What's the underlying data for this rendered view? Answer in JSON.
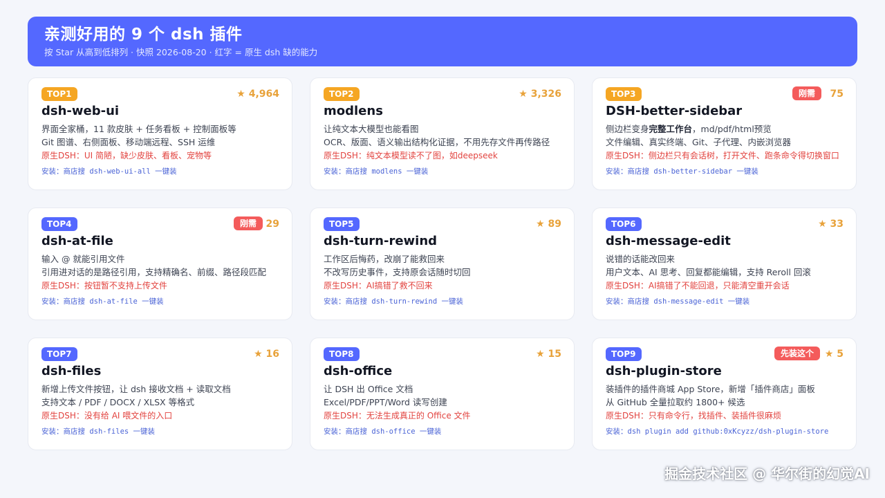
{
  "header": {
    "title": "亲测好用的 9 个 dsh 插件",
    "subtitle": "按 Star 从高到低排列 · 快照 2026-08-20 · 红字 = 原生 dsh 缺的能力"
  },
  "cards": [
    {
      "rank": "TOP1",
      "stars": "★ 4,964",
      "badge": "",
      "name": "dsh-web-ui",
      "desc1": "界面全家桶，11 款皮肤 + 任务看板 + 控制面板等",
      "desc2": "Git 图谱、右侧面板、移动端远程、SSH 运维",
      "native": "原生DSH：UI 简陋，缺少皮肤、看板、宠物等",
      "install": "安装：商店搜 dsh-web-ui-all 一键装"
    },
    {
      "rank": "TOP2",
      "stars": "★ 3,326",
      "badge": "",
      "name": "modlens",
      "desc1": "让纯文本大模型也能看图",
      "desc2": "OCR、版面、语义输出结构化证据，不用先存文件再传路径",
      "native": "原生DSH：纯文本模型读不了图，如deepseek",
      "install": "安装：商店搜 modlens 一键装"
    },
    {
      "rank": "TOP3",
      "stars": "75",
      "badge": "刚需",
      "name": "DSH-better-sidebar",
      "desc1_pre": "侧边栏变身",
      "desc1_bold": "完整工作台",
      "desc1_post": "，md/pdf/html预览",
      "desc2": "文件编辑、真实终端、Git、子代理、内嵌浏览器",
      "native": "原生DSH：侧边栏只有会话树，打开文件、跑条命令得切换窗口",
      "install": "安装：商店搜 dsh-better-sidebar 一键装"
    },
    {
      "rank": "TOP4",
      "stars": "29",
      "badge": "刚需",
      "name": "dsh-at-file",
      "desc1": "输入 @ 就能引用文件",
      "desc2": "引用进对话的是路径引用，支持精确名、前缀、路径段匹配",
      "native": "原生DSH：按钮暂不支持上传文件",
      "install": "安装：商店搜 dsh-at-file 一键装"
    },
    {
      "rank": "TOP5",
      "stars": "★ 89",
      "badge": "",
      "name": "dsh-turn-rewind",
      "desc1": "工作区后悔药，改崩了能救回来",
      "desc2": "不改写历史事件，支持原会话随时切回",
      "native": "原生DSH：AI搞错了救不回来",
      "install": "安装：商店搜 dsh-turn-rewind 一键装"
    },
    {
      "rank": "TOP6",
      "stars": "★ 33",
      "badge": "",
      "name": "dsh-message-edit",
      "desc1": "说错的话能改回来",
      "desc2": "用户文本、AI 思考、回复都能编辑，支持 Reroll 回滚",
      "native": "原生DSH：AI搞错了不能回退，只能清空重开会话",
      "install": "安装：商店搜 dsh-message-edit 一键装"
    },
    {
      "rank": "TOP7",
      "stars": "★ 16",
      "badge": "",
      "name": "dsh-files",
      "desc1": "新增上传文件按钮，让 dsh 接收文档 + 读取文档",
      "desc2": "支持文本 / PDF / DOCX / XLSX 等格式",
      "native": "原生DSH：没有给 AI 喂文件的入口",
      "install": "安装：商店搜 dsh-files 一键装"
    },
    {
      "rank": "TOP8",
      "stars": "★ 15",
      "badge": "",
      "name": "dsh-office",
      "desc1": "让 DSH 出 Office 文档",
      "desc2": "Excel/PDF/PPT/Word 读写创建",
      "native": "原生DSH：无法生成真正的 Office 文件",
      "install": "安装：商店搜 dsh-office 一键装"
    },
    {
      "rank": "TOP9",
      "stars": "★ 5",
      "badge": "先装这个",
      "name": "dsh-plugin-store",
      "desc1": "装插件的插件商城 App Store，新增「插件商店」面板",
      "desc2": "从 GitHub 全量拉取约 1800+ 候选",
      "native": "原生DSH：只有命令行，找插件、装插件很麻烦",
      "install": "安装：dsh plugin add github:0xKcyzz/dsh-plugin-store"
    }
  ],
  "watermark": "掘金技术社区 @ 华尔街的幻觉AI",
  "colors": {
    "accent": "#5468ff",
    "gold": "#f5a623",
    "hot": "#f45b5b",
    "native": "#e2433f",
    "star": "#e8a23a"
  }
}
